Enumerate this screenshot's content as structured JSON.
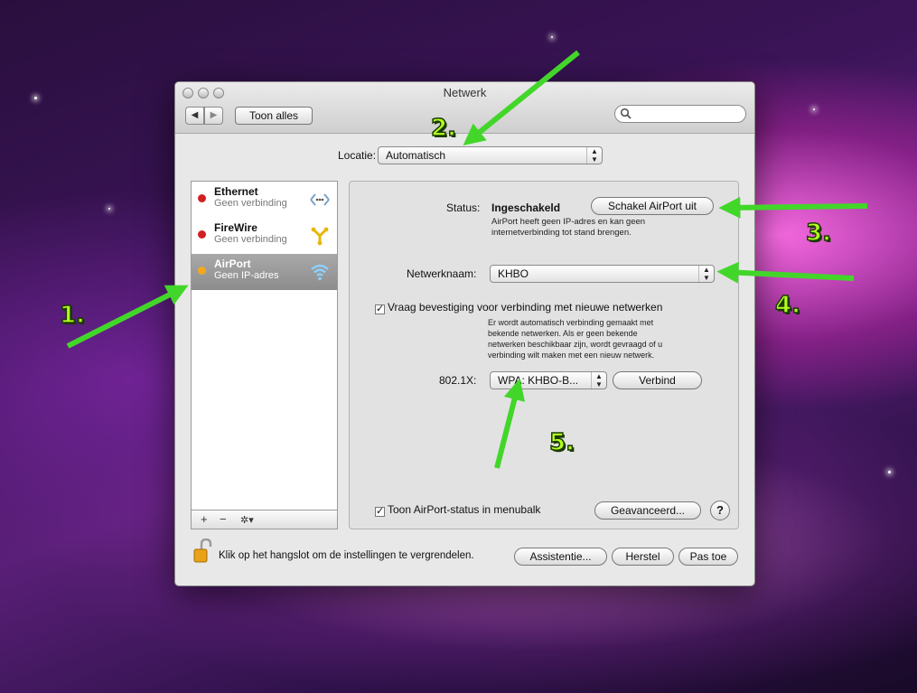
{
  "window": {
    "title": "Netwerk"
  },
  "toolbar": {
    "back": "◀",
    "forward": "▶",
    "show_all": "Toon alles",
    "search_placeholder": ""
  },
  "location": {
    "label": "Locatie:",
    "value": "Automatisch"
  },
  "services": [
    {
      "name": "Ethernet",
      "status": "Geen verbinding",
      "status_color": "#d21f1f"
    },
    {
      "name": "FireWire",
      "status": "Geen verbinding",
      "status_color": "#d21f1f"
    },
    {
      "name": "AirPort",
      "status": "Geen IP-adres",
      "status_color": "#f2a91d"
    }
  ],
  "sidebar_footer": {
    "add": "+",
    "remove": "−",
    "gear": "✲▾"
  },
  "detail": {
    "status_label": "Status:",
    "status_value": "Ingeschakeld",
    "toggle_button": "Schakel AirPort uit",
    "status_desc_1": "AirPort heeft geen IP-adres en kan geen",
    "status_desc_2": "internetverbinding tot stand brengen.",
    "network_name_label": "Netwerknaam:",
    "network_name_value": "KHBO",
    "ask_checkbox": "Vraag bevestiging voor verbinding met nieuwe netwerken",
    "ask_desc": [
      "Er wordt automatisch verbinding gemaakt met",
      "bekende netwerken. Als er geen bekende",
      "netwerken beschikbaar zijn, wordt gevraagd of u",
      "verbinding wilt maken met een nieuw netwerk."
    ],
    "dot1x_label": "802.1X:",
    "dot1x_value": "WPA: KHBO-B...",
    "connect_button": "Verbind",
    "show_status_checkbox": "Toon AirPort-status in menubalk",
    "advanced_button": "Geavanceerd...",
    "help": "?"
  },
  "footer": {
    "lock_text": "Klik op het hangslot om de instellingen te vergrendelen.",
    "assistant_button": "Assistentie...",
    "revert_button": "Herstel",
    "apply_button": "Pas toe"
  },
  "annotations": [
    "1.",
    "2.",
    "3.",
    "4.",
    "5."
  ],
  "colors": {
    "arrow": "#43d62a",
    "marker": "#b4ff20",
    "selected_row": "#9a9a9a"
  }
}
